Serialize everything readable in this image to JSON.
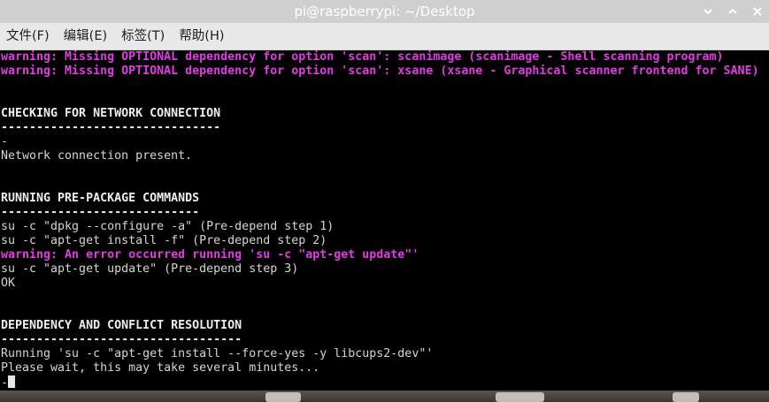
{
  "window": {
    "title": "pi@raspberrypi: ~/Desktop"
  },
  "menubar": {
    "items": [
      "文件(F)",
      "编辑(E)",
      "标签(T)",
      "帮助(H)"
    ]
  },
  "terminal": {
    "lines": [
      {
        "text": "warning: Missing OPTIONAL dependency for option 'scan': scanimage (scanimage - Shell scanning program)",
        "style": "warn"
      },
      {
        "text": "warning: Missing OPTIONAL dependency for option 'scan': xsane (xsane - Graphical scanner frontend for SANE)",
        "style": "warn"
      },
      {
        "text": "",
        "style": "normal"
      },
      {
        "text": "",
        "style": "normal"
      },
      {
        "text": "CHECKING FOR NETWORK CONNECTION",
        "style": "bold"
      },
      {
        "text": "-------------------------------",
        "style": "bold"
      },
      {
        "text": "-",
        "style": "normal"
      },
      {
        "text": "Network connection present.",
        "style": "normal"
      },
      {
        "text": "",
        "style": "normal"
      },
      {
        "text": "",
        "style": "normal"
      },
      {
        "text": "RUNNING PRE-PACKAGE COMMANDS",
        "style": "bold"
      },
      {
        "text": "----------------------------",
        "style": "bold"
      },
      {
        "text": "su -c \"dpkg --configure -a\" (Pre-depend step 1)",
        "style": "normal"
      },
      {
        "text": "su -c \"apt-get install -f\" (Pre-depend step 2)",
        "style": "normal"
      },
      {
        "text": "warning: An error occurred running 'su -c \"apt-get update\"'",
        "style": "warn"
      },
      {
        "text": "su -c \"apt-get update\" (Pre-depend step 3)",
        "style": "normal"
      },
      {
        "text": "OK",
        "style": "normal"
      },
      {
        "text": "",
        "style": "normal"
      },
      {
        "text": "",
        "style": "normal"
      },
      {
        "text": "DEPENDENCY AND CONFLICT RESOLUTION",
        "style": "bold"
      },
      {
        "text": "----------------------------------",
        "style": "bold"
      },
      {
        "text": "Running 'su -c \"apt-get install --force-yes -y libcups2-dev\"'",
        "style": "normal"
      },
      {
        "text": "Please wait, this may take several minutes...",
        "style": "normal"
      },
      {
        "text": "-",
        "style": "cursor"
      }
    ]
  },
  "colors": {
    "warning": "#e03ee0",
    "terminal_bg": "#000000",
    "terminal_fg": "#d3d7cf",
    "titlebar_bg": "#cfcfcf",
    "menubar_bg": "#e8e8e8"
  },
  "icons": {
    "minimize": "chevron-down-icon",
    "maximize": "chevron-up-icon",
    "close": "close-icon"
  }
}
